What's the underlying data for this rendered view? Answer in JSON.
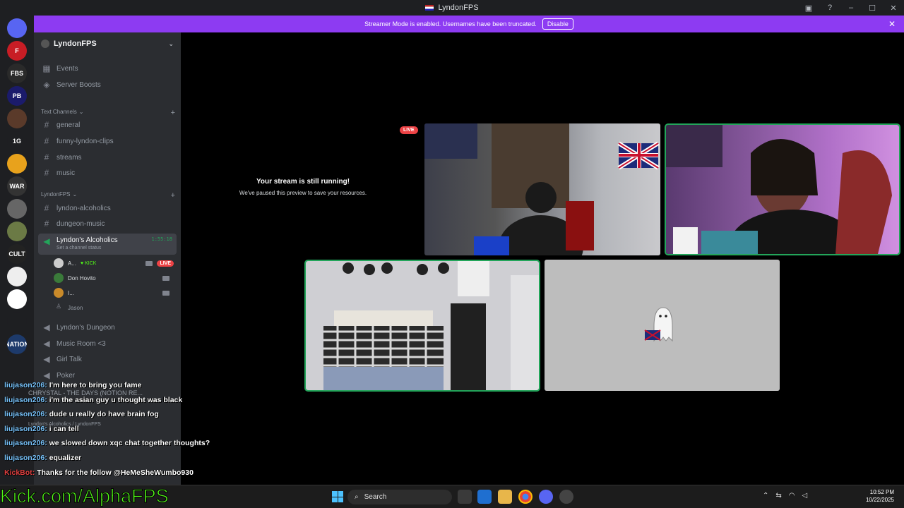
{
  "window": {
    "title": "LyndonFPS"
  },
  "banner": {
    "text": "Streamer Mode is enabled. Usernames have been truncated.",
    "button": "Disable"
  },
  "servers": [
    {
      "label": "",
      "color": "#5865f2"
    },
    {
      "label": "F",
      "color": "#c81d25"
    },
    {
      "label": "FBS",
      "color": "#2a2a2a"
    },
    {
      "label": "PB",
      "color": "#1b1b6b"
    },
    {
      "label": "",
      "color": "#5a3a2a"
    },
    {
      "label": "1G",
      "color": "#1e1f22"
    },
    {
      "label": "",
      "color": "#e8a21c"
    },
    {
      "label": "WAR",
      "color": "#333"
    },
    {
      "label": "",
      "color": "#666"
    },
    {
      "label": "",
      "color": "#6b7a45"
    },
    {
      "label": "CULT",
      "color": "#222"
    },
    {
      "label": "",
      "color": "#eee"
    },
    {
      "label": "",
      "color": "#fff"
    },
    {
      "label": "",
      "color": "#1e1f22"
    },
    {
      "label": "NATION",
      "color": "#1d3a6b"
    }
  ],
  "sidebar": {
    "guild_name": "LyndonFPS",
    "events": "Events",
    "boosts": "Server Boosts",
    "cat_text": "Text Channels",
    "text_channels": [
      "general",
      "funny-lyndon-clips",
      "streams",
      "music"
    ],
    "cat_lyndon": "LyndonFPS",
    "lyndon_channels": [
      "lyndon-alcoholics",
      "dungeon-music"
    ],
    "voice_active": "Lyndon's Alcoholics",
    "voice_timer": "1:55:18",
    "voice_status": "Set a channel status",
    "members": [
      {
        "name": "A...",
        "tag": "KICK",
        "live": "LIVE"
      },
      {
        "name": "Don Hovito"
      },
      {
        "name": "I..."
      },
      {
        "name": "Jason"
      }
    ],
    "voice_channels": [
      "Lyndon's Dungeon",
      "Music Room <3",
      "Girl Talk",
      "Poker"
    ],
    "now_playing": "CHRYSTAL - THE DAYS (NOTION RE...",
    "voice_path": "Lyndon's Alcoholics / LyndonFPS"
  },
  "stage": {
    "paused_title": "Your stream is still running!",
    "paused_sub": "We've paused this preview to save your resources.",
    "live": "LIVE"
  },
  "chat": [
    {
      "user": "liujason206",
      "msg": "I'm here to bring you fame"
    },
    {
      "user": "liujason206",
      "msg": "i'm the asian guy u thought was black"
    },
    {
      "user": "liujason206",
      "msg": "dude u really do have brain fog"
    },
    {
      "user": "liujason206",
      "msg": "i can tell"
    },
    {
      "user": "liujason206",
      "msg": "we slowed down xqc chat together thoughts?"
    },
    {
      "user": "liujason206",
      "msg": "equalizer"
    },
    {
      "user": "KickBot",
      "msg": "Thanks for the follow @HeMeSheWumbo930"
    }
  ],
  "overlay_url": "Kick.com/AlphaFPS",
  "taskbar": {
    "search": "Search",
    "time": "10:52 PM",
    "date": "10/22/2025"
  }
}
